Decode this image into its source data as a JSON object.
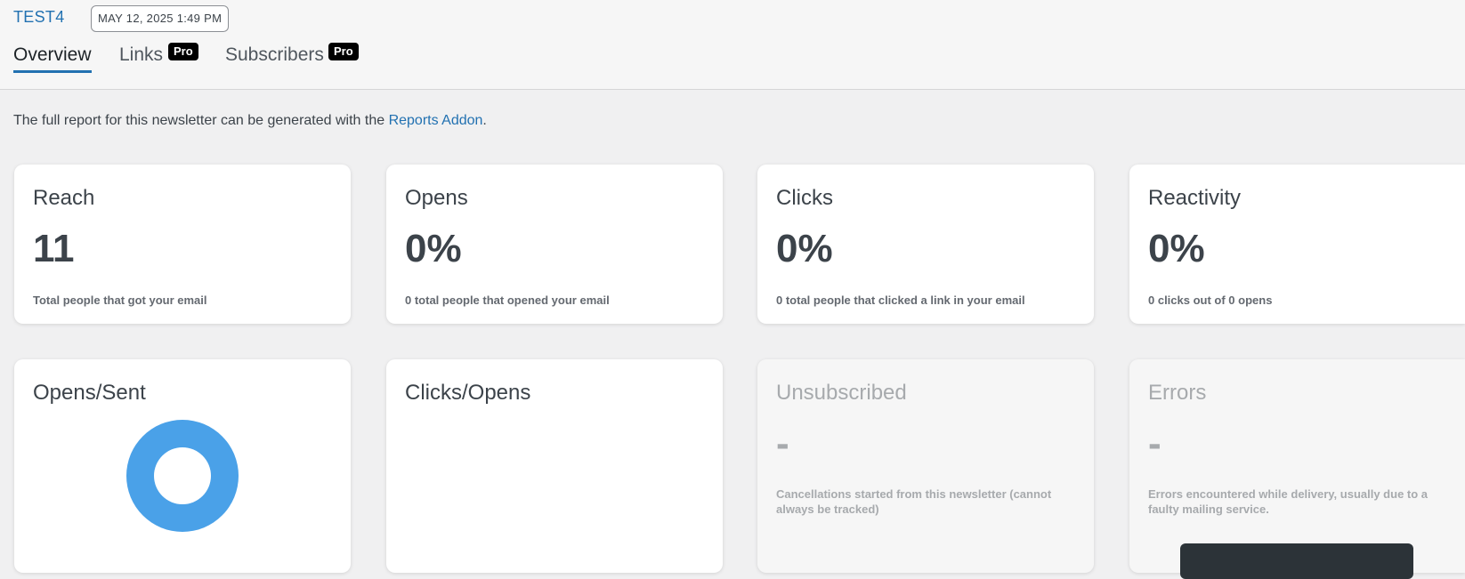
{
  "header": {
    "newsletter_name": "TEST4",
    "date": "MAY 12, 2025 1:49 PM",
    "tabs": [
      {
        "label": "Overview",
        "badge": ""
      },
      {
        "label": "Links",
        "badge": "Pro"
      },
      {
        "label": "Subscribers",
        "badge": "Pro"
      }
    ]
  },
  "notice": {
    "text_before": "The full report for this newsletter can be generated with the ",
    "link": "Reports Addon",
    "text_after": "."
  },
  "stats": [
    {
      "title": "Reach",
      "value": "11",
      "desc": "Total people that got your email"
    },
    {
      "title": "Opens",
      "value": "0%",
      "desc": "0 total people that opened your email"
    },
    {
      "title": "Clicks",
      "value": "0%",
      "desc": "0 total people that clicked a link in your email"
    },
    {
      "title": "Reactivity",
      "value": "0%",
      "desc": "0 clicks out of 0 opens"
    }
  ],
  "charts": [
    {
      "title": "Opens/Sent"
    },
    {
      "title": "Clicks/Opens"
    }
  ],
  "disabled_cards": [
    {
      "title": "Unsubscribed",
      "value": "-",
      "desc": "Cancellations started from this newsletter (cannot always be tracked)"
    },
    {
      "title": "Errors",
      "value": "-",
      "desc": "Errors encountered while delivery, usually due to a faulty mailing service."
    }
  ],
  "colors": {
    "accent": "#2271b1",
    "donut": "#4aa1e8",
    "background": "#f0f0f1"
  }
}
